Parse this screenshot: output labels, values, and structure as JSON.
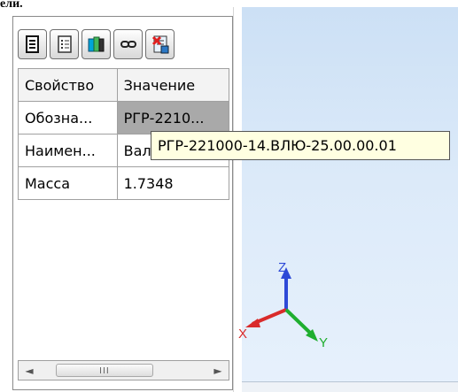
{
  "top_fragment": "ели.",
  "toolbar": {
    "buttons": [
      {
        "name": "document-icon"
      },
      {
        "name": "list-icon"
      },
      {
        "name": "book-icon"
      },
      {
        "name": "link-icon"
      },
      {
        "name": "delete-properties-icon"
      }
    ]
  },
  "grid": {
    "header": {
      "name": "Свойство",
      "value": "Значение"
    },
    "rows": [
      {
        "name": "Обозна...",
        "value": "РГР-2210...",
        "selected": true
      },
      {
        "name": "Наимен...",
        "value": "Вал"
      },
      {
        "name": "Масса",
        "value": "1.7348"
      }
    ]
  },
  "tooltip": {
    "text": "РГР-221000-14.ВЛЮ-25.00.00.01"
  },
  "scroll": {
    "left_arrow": "◄",
    "right_arrow": "►",
    "grip": "III"
  },
  "triad": {
    "z_label": "Z",
    "y_label": "Y",
    "x_label": "X"
  },
  "colors": {
    "selected_cell": "#a9a9a9",
    "tooltip_bg": "#ffffe1",
    "viewport": "#dceaf9"
  }
}
